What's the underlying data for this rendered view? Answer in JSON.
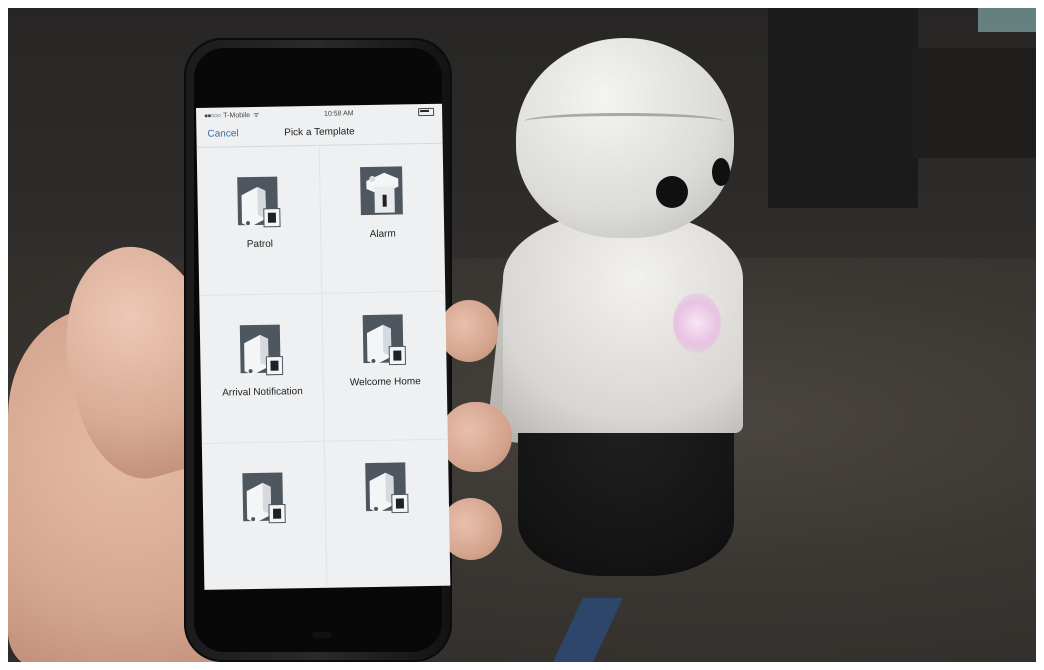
{
  "status_bar": {
    "carrier": "T-Mobile",
    "time": "10:58 AM"
  },
  "nav": {
    "cancel_label": "Cancel",
    "title": "Pick a Template"
  },
  "templates": [
    {
      "label": "Patrol",
      "icon": "camera-template-icon"
    },
    {
      "label": "Alarm",
      "icon": "alarm-template-icon"
    },
    {
      "label": "Arrival Notification",
      "icon": "camera-template-icon"
    },
    {
      "label": "Welcome Home",
      "icon": "camera-template-icon"
    },
    {
      "label": "",
      "icon": "camera-template-icon"
    },
    {
      "label": "",
      "icon": "camera-template-icon"
    }
  ],
  "colors": {
    "link": "#3a6fa5",
    "screen_background": "#eef0f2",
    "icon_frame": "#4e5660"
  }
}
